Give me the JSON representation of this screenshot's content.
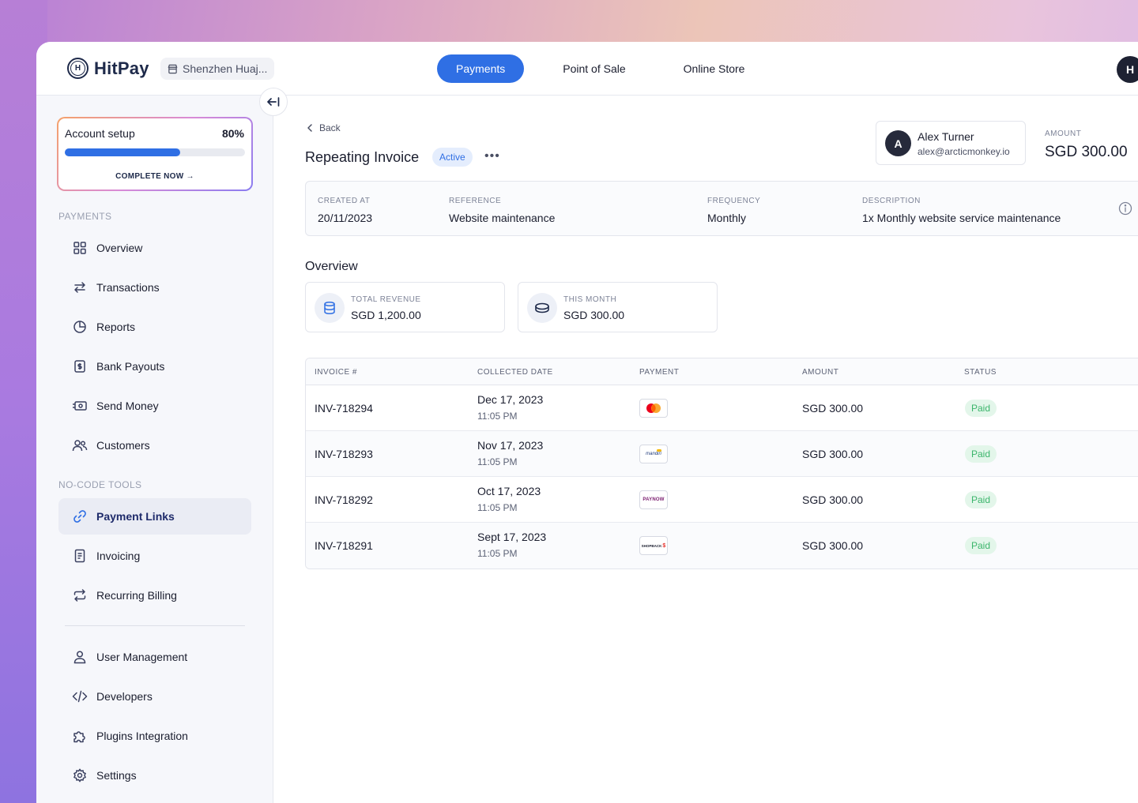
{
  "header": {
    "brand": "HitPay",
    "store": "Shenzhen Huaj...",
    "nav": [
      {
        "label": "Payments",
        "active": true
      },
      {
        "label": "Point of Sale",
        "active": false
      },
      {
        "label": "Online Store",
        "active": false
      }
    ],
    "user_initial": "H"
  },
  "sidebar": {
    "setup": {
      "title": "Account setup",
      "percent_label": "80%",
      "progress": 0.64,
      "cta": "COMPLETE NOW →"
    },
    "payments_label": "PAYMENTS",
    "payments_items": [
      {
        "label": "Overview",
        "icon": "grid-icon"
      },
      {
        "label": "Transactions",
        "icon": "arrows-icon"
      },
      {
        "label": "Reports",
        "icon": "pie-chart-icon"
      },
      {
        "label": "Bank Payouts",
        "icon": "bank-payout-icon"
      },
      {
        "label": "Send Money",
        "icon": "send-money-icon"
      },
      {
        "label": "Customers",
        "icon": "users-icon"
      }
    ],
    "tools_label": "NO-CODE TOOLS",
    "tools_items": [
      {
        "label": "Payment Links",
        "icon": "link-icon",
        "active": true
      },
      {
        "label": "Invoicing",
        "icon": "invoice-icon"
      },
      {
        "label": "Recurring Billing",
        "icon": "repeat-icon"
      }
    ],
    "settings_items": [
      {
        "label": "User Management",
        "icon": "user-icon"
      },
      {
        "label": "Developers",
        "icon": "code-icon"
      },
      {
        "label": "Plugins Integration",
        "icon": "puzzle-icon"
      },
      {
        "label": "Settings",
        "icon": "gear-icon"
      }
    ]
  },
  "main": {
    "back_label": "Back",
    "title": "Repeating Invoice",
    "status": "Active",
    "more": "•••",
    "customer": {
      "initial": "A",
      "name": "Alex Turner",
      "email": "alex@arcticmonkey.io"
    },
    "amount_label": "AMOUNT",
    "amount_value": "SGD 300.00",
    "details": [
      {
        "label": "CREATED AT",
        "value": "20/11/2023"
      },
      {
        "label": "REFERENCE",
        "value": "Website maintenance"
      },
      {
        "label": "FREQUENCY",
        "value": "Monthly"
      },
      {
        "label": "DESCRIPTION",
        "value": "1x Monthly website service maintenance"
      }
    ],
    "overview_title": "Overview",
    "stats": [
      {
        "label": "TOTAL REVENUE",
        "value": "SGD 1,200.00",
        "icon": "database-icon"
      },
      {
        "label": "THIS MONTH",
        "value": "SGD 300.00",
        "icon": "coins-icon"
      }
    ],
    "table": {
      "headers": [
        "INVOICE #",
        "COLLECTED DATE",
        "PAYMENT",
        "AMOUNT",
        "STATUS"
      ],
      "rows": [
        {
          "invoice": "INV-718294",
          "date": "Dec 17, 2023",
          "time": "11:05 PM",
          "payment": "mastercard-logo",
          "amount": "SGD 300.00",
          "status": "Paid"
        },
        {
          "invoice": "INV-718293",
          "date": "Nov 17, 2023",
          "time": "11:05 PM",
          "payment": "mandiri-logo",
          "payment_text": "mandiri",
          "amount": "SGD 300.00",
          "status": "Paid"
        },
        {
          "invoice": "INV-718292",
          "date": "Oct 17, 2023",
          "time": "11:05 PM",
          "payment": "paynow-logo",
          "payment_text": "PAYNOW",
          "amount": "SGD 300.00",
          "status": "Paid"
        },
        {
          "invoice": "INV-718291",
          "date": "Sept 17, 2023",
          "time": "11:05 PM",
          "payment": "shopback-logo",
          "payment_text": "SHOPBACK",
          "amount": "SGD 300.00",
          "status": "Paid"
        }
      ]
    }
  },
  "colors": {
    "accent": "#2f6fe4",
    "paid_bg": "#e3f6ea",
    "paid_text": "#3bb56b",
    "active_badge_bg": "#e4edfd"
  }
}
